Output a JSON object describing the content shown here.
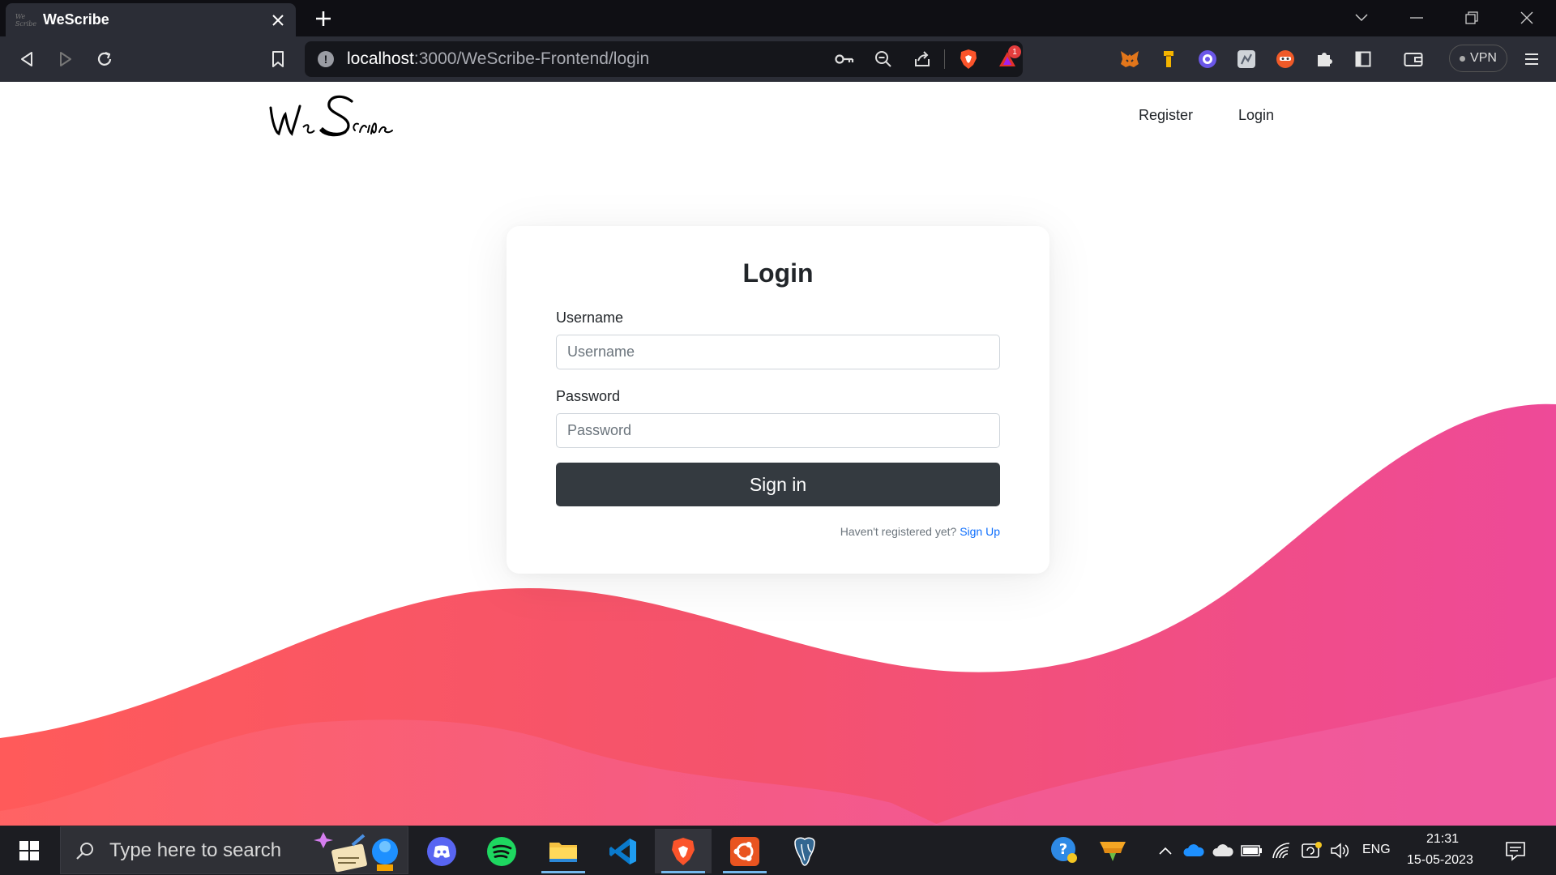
{
  "browser": {
    "tab_title": "WeScribe",
    "tab_favicon_text": "We Scribe",
    "url_host": "localhost",
    "url_path": ":3000/WeScribe-Frontend/login",
    "alerts_badge": "1",
    "vpn_label": "VPN",
    "extensions": [
      "metamask-icon",
      "pencil-extension-icon",
      "blue-circle-extension-icon",
      "gray-extension-icon",
      "orange-extension-icon",
      "puzzle-icon"
    ]
  },
  "site": {
    "logo_text": "We Scribe",
    "nav": {
      "register": "Register",
      "login": "Login"
    }
  },
  "login_form": {
    "title": "Login",
    "username_label": "Username",
    "username_placeholder": "Username",
    "username_value": "",
    "password_label": "Password",
    "password_placeholder": "Password",
    "password_value": "",
    "submit_label": "Sign in",
    "register_prompt": "Haven't registered yet?",
    "register_link": "Sign Up"
  },
  "taskbar": {
    "search_placeholder": "Type here to search",
    "apps": [
      "discord-icon",
      "spotify-icon",
      "file-explorer-icon",
      "vscode-icon",
      "brave-icon",
      "ubuntu-icon",
      "postgresql-icon"
    ],
    "language": "ENG",
    "time": "21:31",
    "date": "15-05-2023"
  },
  "colors": {
    "wave_start": "#ff5858",
    "wave_end": "#ee4a98",
    "button_dark": "#343a40",
    "link_blue": "#0d6efd"
  }
}
